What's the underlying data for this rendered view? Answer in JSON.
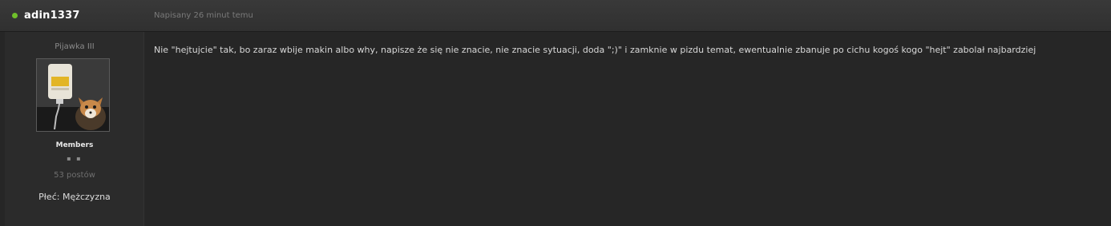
{
  "post": {
    "author": "adin1337",
    "date": "Napisany 26 minut temu",
    "online_color": "#6fbf2a",
    "author_panel": {
      "rank_title": "Pijawka III",
      "group": "Members",
      "pips": "▪ ▪",
      "post_count": "53 postów",
      "gender": "Płeć: Mężczyzna"
    },
    "body": "Nie \"hejtujcie\" tak, bo zaraz wbije makin albo why, napisze że się nie znacie, nie znacie sytuacji, doda \";)\" i zamknie w pizdu temat, ewentualnie zbanuje po cichu kogoś kogo \"hejt\" zabolał najbardziej"
  }
}
